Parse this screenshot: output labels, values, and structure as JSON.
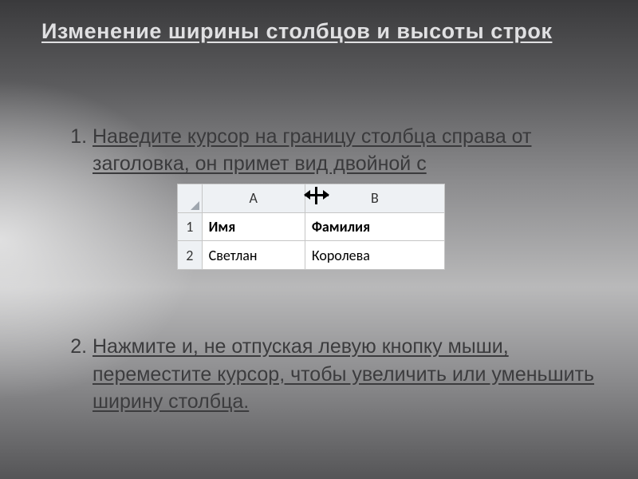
{
  "title": "Изменение ширины столбцов и высоты строк",
  "steps": {
    "s1": "Наведите курсор на границу столбца справа от заголовка, он примет вид двойной с",
    "s2": "Нажмите и, не отпуская левую кнопку мыши, переместите курсор, чтобы увеличить или уменьшить ширину столбца."
  },
  "excel": {
    "cols": {
      "a": "А",
      "b": "B"
    },
    "rows": {
      "r1": {
        "n": "1",
        "a": "Имя",
        "b": "Фамилия"
      },
      "r2": {
        "n": "2",
        "a": "Светлан",
        "b": "Королева"
      }
    }
  },
  "cursor_icon": "resize-horizontal-icon"
}
